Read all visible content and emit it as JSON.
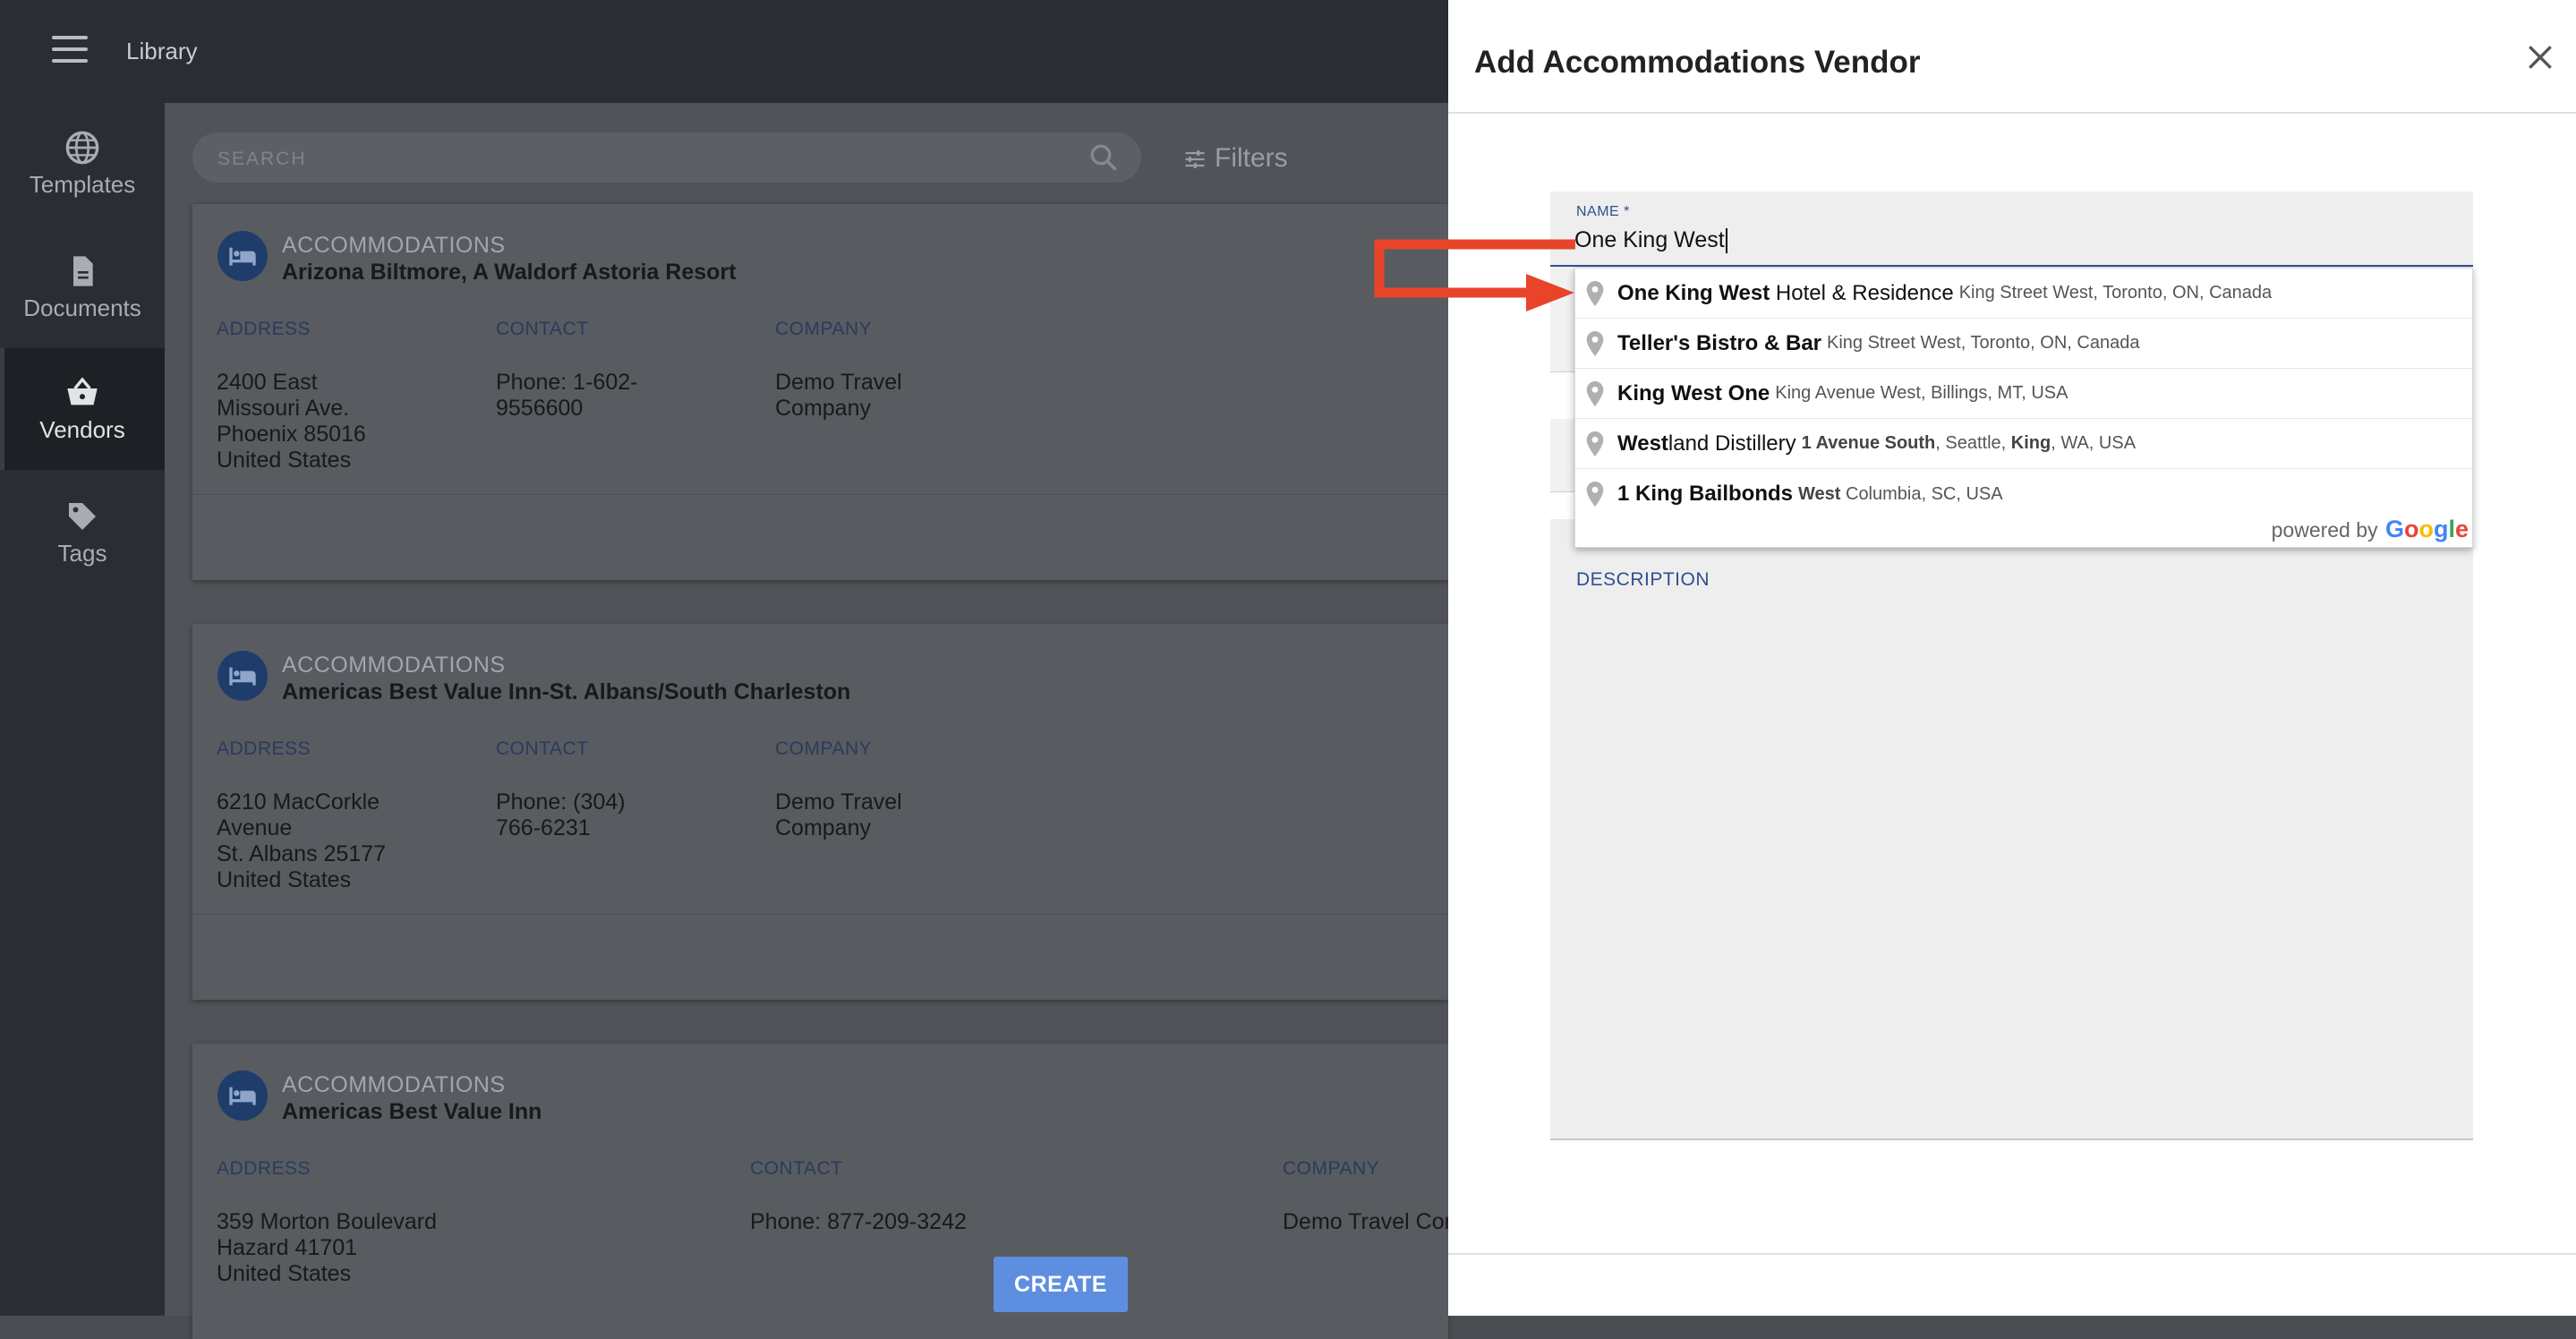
{
  "topbar": {
    "title": "Library"
  },
  "sidebar": {
    "items": [
      {
        "label": "Templates",
        "icon": "globe-icon"
      },
      {
        "label": "Documents",
        "icon": "document-icon"
      },
      {
        "label": "Vendors",
        "icon": "basket-icon",
        "active": true
      },
      {
        "label": "Tags",
        "icon": "tag-icon"
      }
    ]
  },
  "main": {
    "search_placeholder": "SEARCH",
    "filters_label": "Filters",
    "column_headers": {
      "address": "ADDRESS",
      "contact": "CONTACT",
      "company": "COMPANY"
    },
    "cards": [
      {
        "category": "ACCOMMODATIONS",
        "title": "Arizona Biltmore, A Waldorf Astoria Resort",
        "address": [
          "2400 East",
          "Missouri Ave.",
          "Phoenix 85016",
          "United States"
        ],
        "contact": [
          "Phone: 1-602-",
          "9556600"
        ],
        "company": [
          "Demo Travel",
          "Company"
        ]
      },
      {
        "category": "ACCOMMODATIONS",
        "title": "Americas Best Value Inn-St. Albans/South Charleston",
        "address": [
          "6210 MacCorkle",
          "Avenue",
          "St. Albans 25177",
          "United States"
        ],
        "contact": [
          "Phone: (304)",
          "766-6231"
        ],
        "company": [
          "Demo Travel",
          "Company"
        ]
      },
      {
        "category": "ACCOMMODATIONS",
        "title": "Americas Best Value Inn",
        "address": [
          "359 Morton Boulevard",
          "Hazard 41701",
          "United States"
        ],
        "contact": [
          "Phone: 877-209-3242"
        ],
        "company": [
          "Demo Travel Cor"
        ]
      }
    ]
  },
  "drawer": {
    "title": "Add Accommodations Vendor",
    "name_label": "NAME *",
    "name_value": "One King West",
    "description_label": "DESCRIPTION",
    "create_label": "CREATE"
  },
  "autocomplete": {
    "items": [
      {
        "main_bold": "One King West",
        "main_rest": " Hotel & Residence",
        "secondary": "King Street West, Toronto, ON, Canada"
      },
      {
        "main_bold": "Teller's Bistro & Bar",
        "main_rest": "",
        "secondary": "King Street West, Toronto, ON, Canada"
      },
      {
        "main_bold": "King West One",
        "main_rest": "",
        "secondary": "King Avenue West, Billings, MT, USA"
      },
      {
        "main_bold": "West",
        "main_rest": "land Distillery",
        "secondary_bold1": "1 Avenue South",
        "secondary_mid": ", Seattle, ",
        "secondary_bold2": "King",
        "secondary_end": ", WA, USA"
      },
      {
        "main_bold": "1 King Bailbonds",
        "main_rest": "",
        "secondary_bold1": "West",
        "secondary_end": " Columbia, SC, USA"
      }
    ],
    "powered_by": "powered by",
    "google_letters": [
      "G",
      "o",
      "o",
      "g",
      "l",
      "e"
    ]
  },
  "colors": {
    "accent": "#2f4f8f",
    "create_button": "#5e8ee0",
    "annotation_arrow": "#e8442a"
  }
}
